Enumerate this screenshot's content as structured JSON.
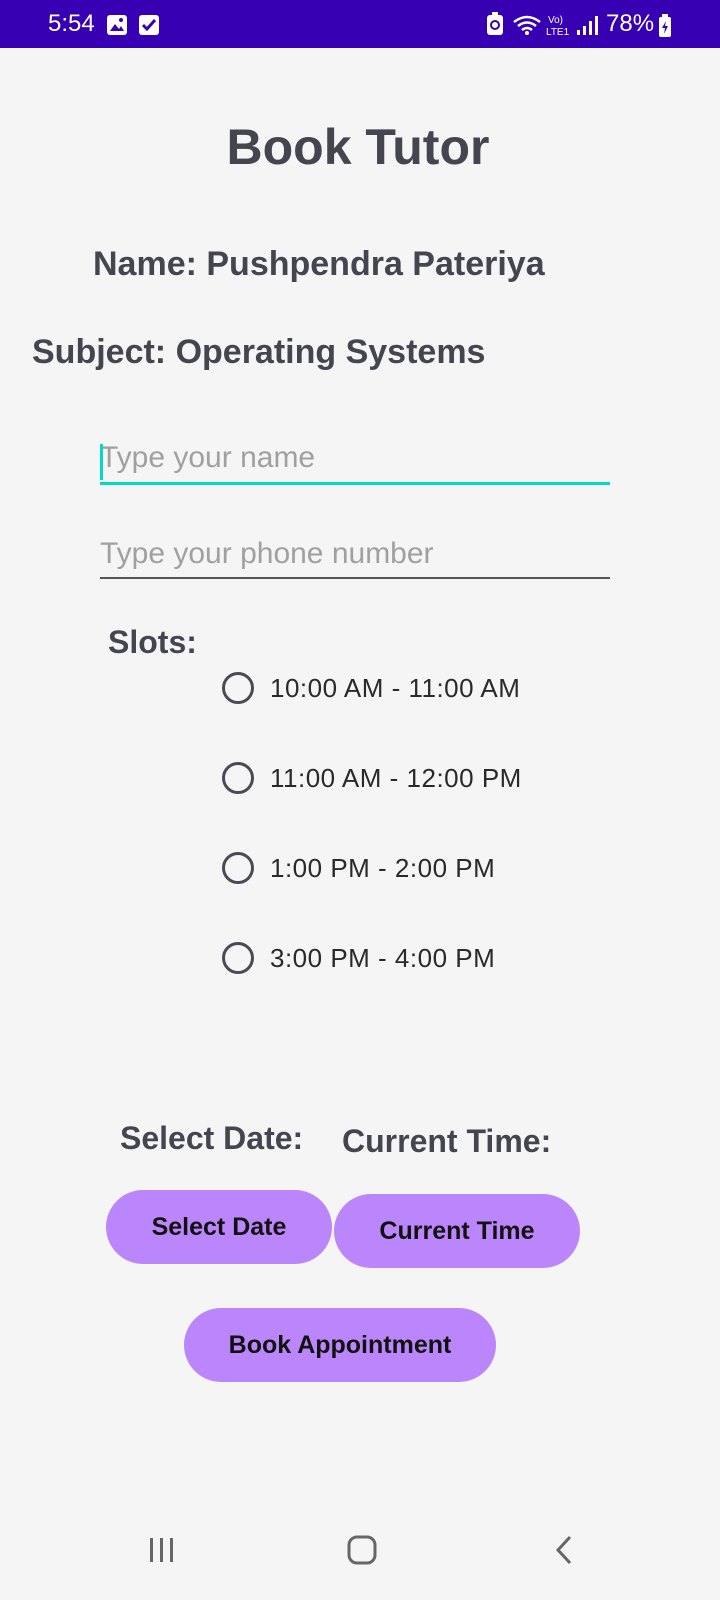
{
  "status_bar": {
    "time": "5:54",
    "battery": "78%",
    "icons": [
      "gallery-icon",
      "checkbox-icon",
      "recycle-icon",
      "wifi-icon",
      "volte-icon",
      "signal-icon",
      "battery-icon"
    ]
  },
  "page": {
    "title": "Book Tutor",
    "name_line": "Name: Pushpendra Pateriya",
    "subject_line": "Subject: Operating Systems"
  },
  "form": {
    "name_placeholder": "Type your name",
    "name_value": "",
    "phone_placeholder": "Type your phone number",
    "phone_value": ""
  },
  "slots": {
    "label": "Slots:",
    "options": [
      "10:00 AM - 11:00 AM",
      "11:00 AM - 12:00 PM",
      "1:00 PM - 2:00 PM",
      "3:00 PM - 4:00 PM"
    ]
  },
  "date_time": {
    "select_date_label": "Select Date:",
    "current_time_label": "Current Time:",
    "select_date_button": "Select Date",
    "current_time_button": "Current Time"
  },
  "actions": {
    "book_button": "Book Appointment"
  },
  "nav": {
    "icons": [
      "recent-apps-icon",
      "home-icon",
      "back-icon"
    ]
  },
  "colors": {
    "status_bar": "#3700b3",
    "accent": "#03dac5",
    "button": "#bb86fc",
    "text_heading": "#454550",
    "background": "#f5f5f5"
  }
}
